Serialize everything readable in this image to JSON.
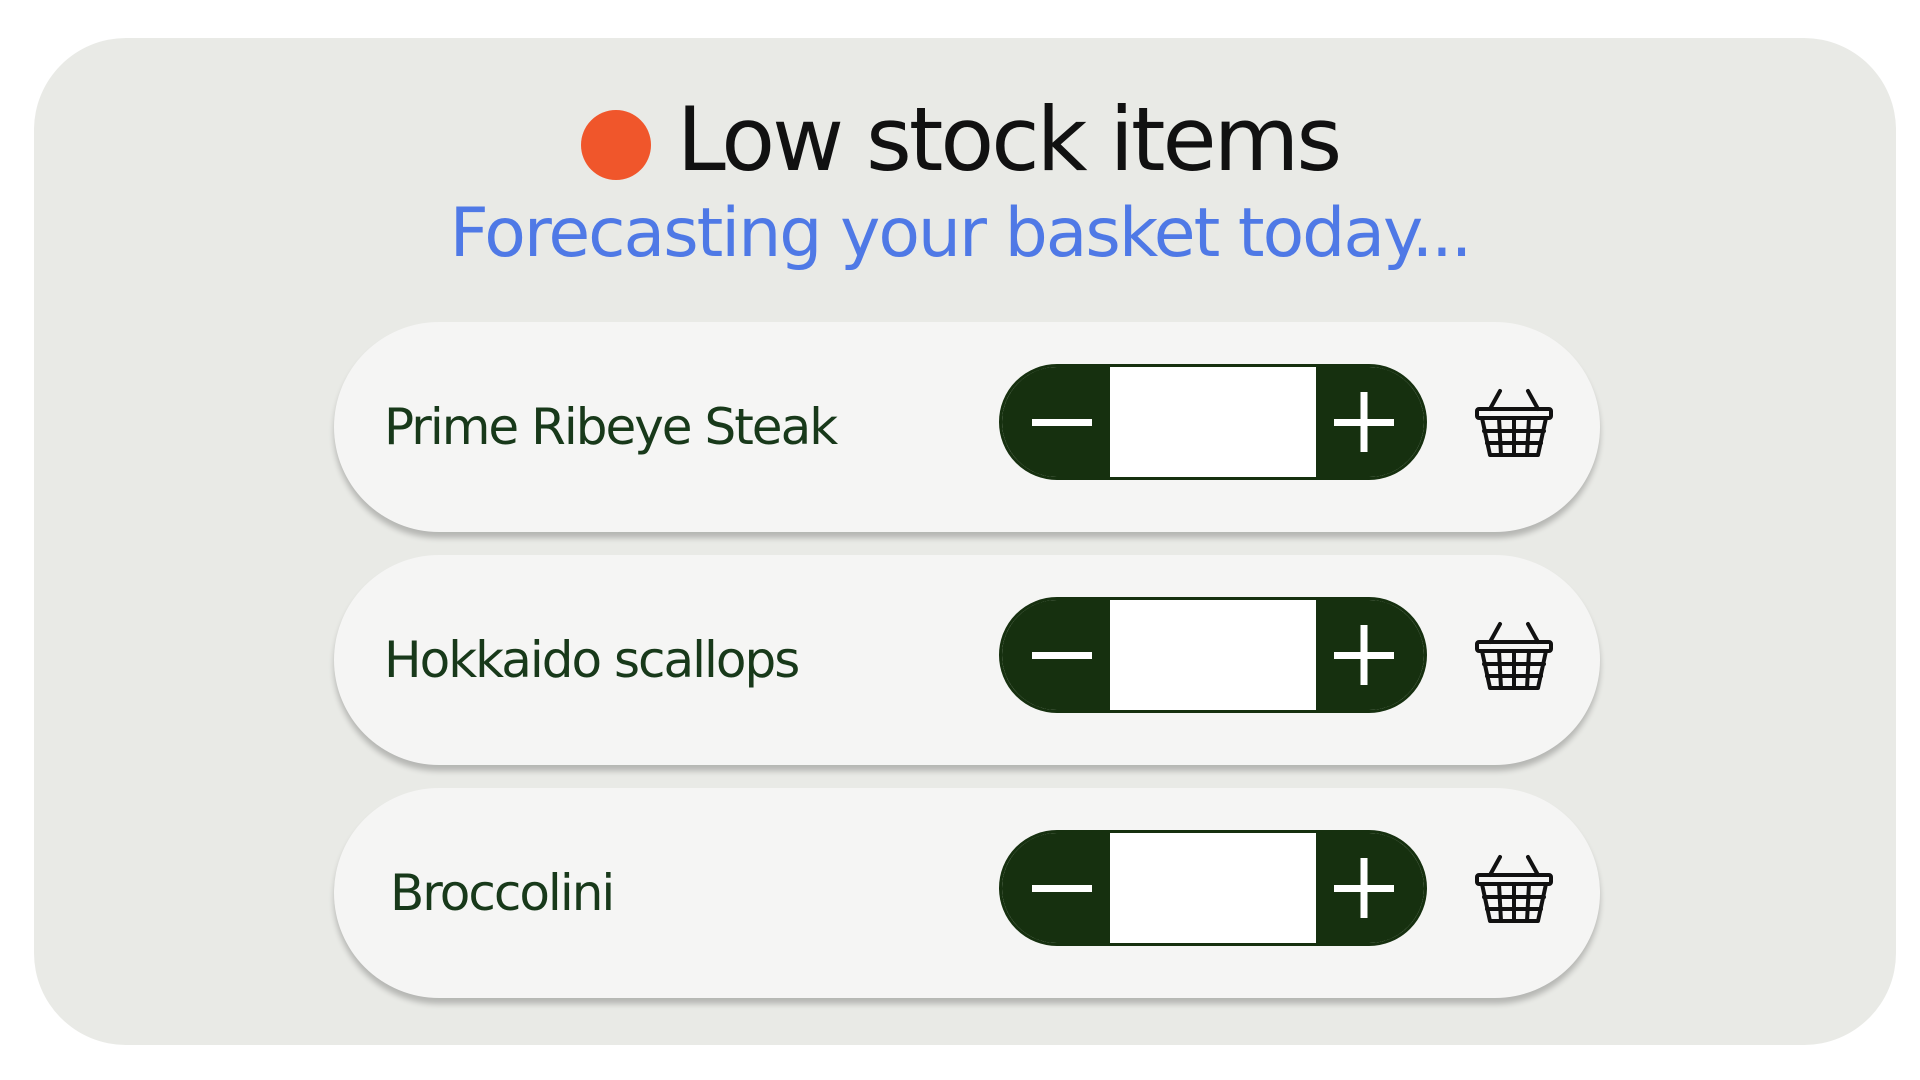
{
  "header": {
    "title": "Low stock items",
    "subtitle": "Forecasting your basket today...",
    "status_dot_color": "#f0562b"
  },
  "colors": {
    "card_background": "#e9eae6",
    "row_background": "#f5f5f4",
    "stepper_dark": "#16300f",
    "item_text": "#18391a",
    "subtitle_text": "#4f79e6"
  },
  "items": [
    {
      "name": "Prime Ribeye Steak",
      "quantity": "",
      "decrement_icon": "minus-icon",
      "increment_icon": "plus-icon",
      "cart_icon": "basket-icon"
    },
    {
      "name": "Hokkaido scallops",
      "quantity": "",
      "decrement_icon": "minus-icon",
      "increment_icon": "plus-icon",
      "cart_icon": "basket-icon"
    },
    {
      "name": "Broccolini",
      "quantity": "",
      "decrement_icon": "minus-icon",
      "increment_icon": "plus-icon",
      "cart_icon": "basket-icon"
    }
  ]
}
